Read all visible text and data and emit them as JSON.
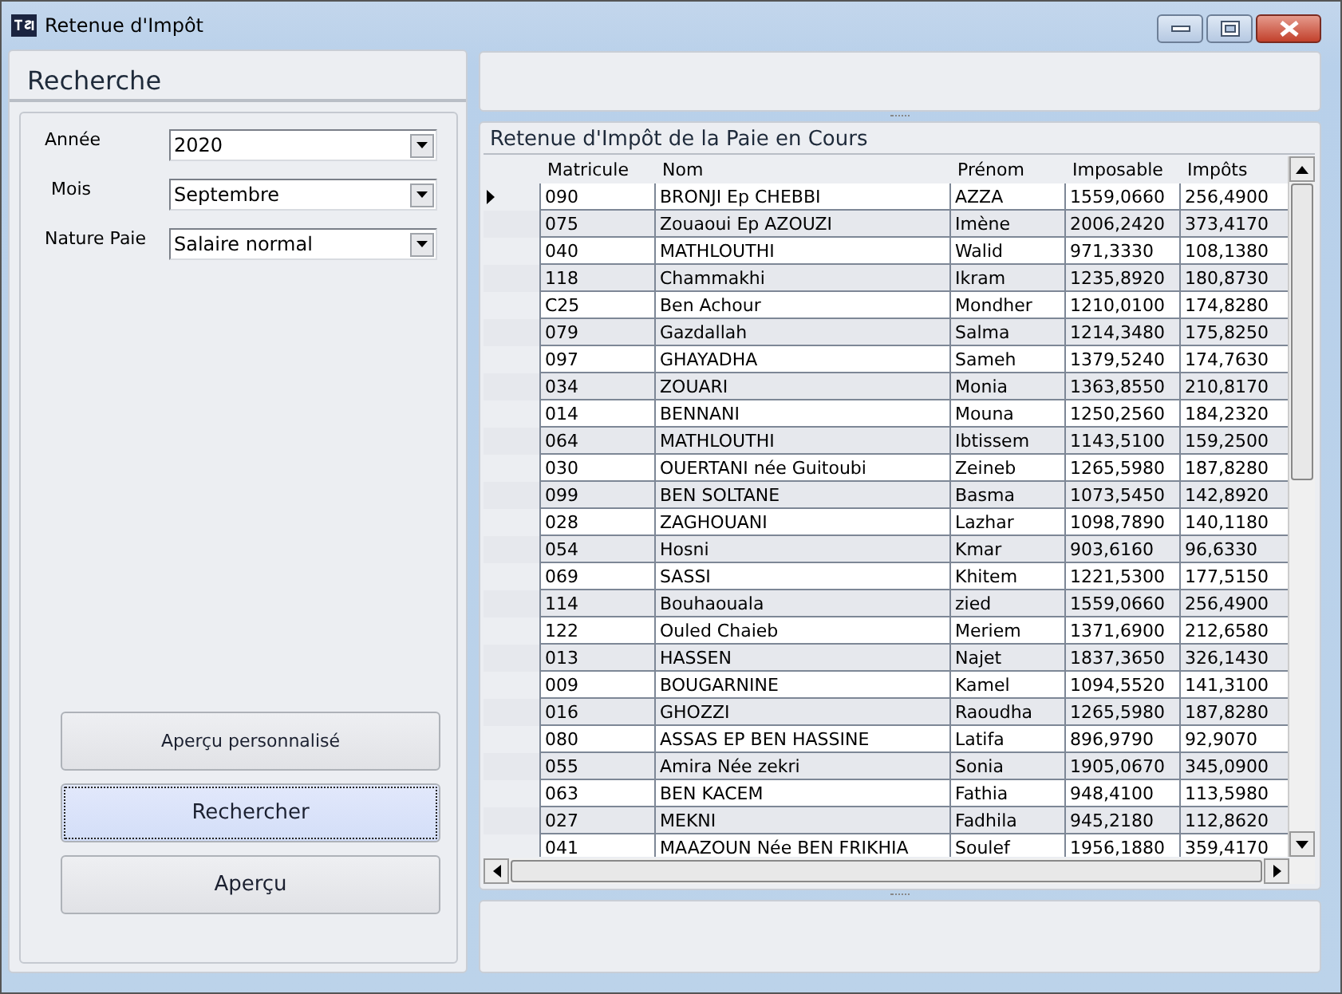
{
  "window": {
    "title": "Retenue d'Impôt",
    "controls": [
      {
        "kind": "minimize"
      },
      {
        "kind": "maximize"
      },
      {
        "kind": "close"
      }
    ]
  },
  "search_panel": {
    "title": "Recherche",
    "fields": [
      {
        "label": "Année",
        "value": "2020"
      },
      {
        "label": "Mois",
        "value": "Septembre"
      },
      {
        "label": "Nature Paie",
        "value": "Salaire normal"
      }
    ],
    "buttons": [
      {
        "label": "Aperçu personnalisé",
        "focused": false
      },
      {
        "label": "Rechercher",
        "focused": true
      },
      {
        "label": "Aperçu",
        "focused": false
      }
    ]
  },
  "grid": {
    "title": "Retenue d'Impôt de la Paie en Cours",
    "columns": [
      "Matricule",
      "Nom",
      "Prénom",
      "Imposable",
      "Impôts"
    ],
    "rows": [
      {
        "current": true,
        "cells": [
          "090",
          "BRONJI Ep CHEBBI",
          "AZZA",
          "1559,0660",
          "256,4900"
        ]
      },
      {
        "current": false,
        "cells": [
          "075",
          "Zouaoui Ep AZOUZI",
          "Imène",
          "2006,2420",
          "373,4170"
        ]
      },
      {
        "current": false,
        "cells": [
          "040",
          "MATHLOUTHI",
          "Walid",
          "971,3330",
          "108,1380"
        ]
      },
      {
        "current": false,
        "cells": [
          "118",
          "Chammakhi",
          "Ikram",
          "1235,8920",
          "180,8730"
        ]
      },
      {
        "current": false,
        "cells": [
          "C25",
          "Ben Achour",
          "Mondher",
          "1210,0100",
          "174,8280"
        ]
      },
      {
        "current": false,
        "cells": [
          "079",
          "Gazdallah",
          "Salma",
          "1214,3480",
          "175,8250"
        ]
      },
      {
        "current": false,
        "cells": [
          "097",
          "GHAYADHA",
          "Sameh",
          "1379,5240",
          "174,7630"
        ]
      },
      {
        "current": false,
        "cells": [
          "034",
          "ZOUARI",
          "Monia",
          "1363,8550",
          "210,8170"
        ]
      },
      {
        "current": false,
        "cells": [
          "014",
          "BENNANI",
          "Mouna",
          "1250,2560",
          "184,2320"
        ]
      },
      {
        "current": false,
        "cells": [
          "064",
          "MATHLOUTHI",
          "Ibtissem",
          "1143,5100",
          "159,2500"
        ]
      },
      {
        "current": false,
        "cells": [
          "030",
          "OUERTANI née Guitoubi",
          "Zeineb",
          "1265,5980",
          "187,8280"
        ]
      },
      {
        "current": false,
        "cells": [
          "099",
          "BEN SOLTANE",
          "Basma",
          "1073,5450",
          "142,8920"
        ]
      },
      {
        "current": false,
        "cells": [
          "028",
          "ZAGHOUANI",
          "Lazhar",
          "1098,7890",
          "140,1180"
        ]
      },
      {
        "current": false,
        "cells": [
          "054",
          "Hosni",
          "Kmar",
          "903,6160",
          "96,6330"
        ]
      },
      {
        "current": false,
        "cells": [
          "069",
          "SASSI",
          "Khitem",
          "1221,5300",
          "177,5150"
        ]
      },
      {
        "current": false,
        "cells": [
          "114",
          "Bouhaouala",
          "zied",
          "1559,0660",
          "256,4900"
        ]
      },
      {
        "current": false,
        "cells": [
          "122",
          "Ouled Chaieb",
          "Meriem",
          "1371,6900",
          "212,6580"
        ]
      },
      {
        "current": false,
        "cells": [
          "013",
          "HASSEN",
          "Najet",
          "1837,3650",
          "326,1430"
        ]
      },
      {
        "current": false,
        "cells": [
          "009",
          "BOUGARNINE",
          "Kamel",
          "1094,5520",
          "141,3100"
        ]
      },
      {
        "current": false,
        "cells": [
          "016",
          "GHOZZI",
          "Raoudha",
          "1265,5980",
          "187,8280"
        ]
      },
      {
        "current": false,
        "cells": [
          "080",
          "ASSAS EP BEN HASSINE",
          "Latifa",
          "896,9790",
          "92,9070"
        ]
      },
      {
        "current": false,
        "cells": [
          "055",
          "Amira Née zekri",
          "Sonia",
          "1905,0670",
          "345,0900"
        ]
      },
      {
        "current": false,
        "cells": [
          "063",
          "BEN KACEM",
          "Fathia",
          "948,4100",
          "113,5980"
        ]
      },
      {
        "current": false,
        "cells": [
          "027",
          "MEKNI",
          "Fadhila",
          "945,2180",
          "112,8620"
        ]
      },
      {
        "current": false,
        "cells": [
          "041",
          "MAAZOUN Née BEN FRIKHIA",
          "Soulef",
          "1956,1880",
          "359,4170"
        ]
      }
    ]
  }
}
